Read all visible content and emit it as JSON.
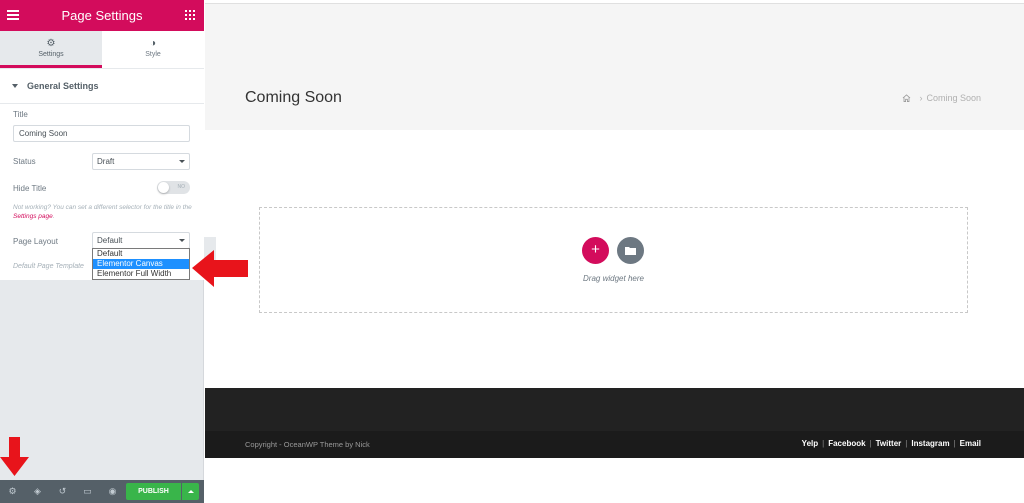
{
  "panel": {
    "header": {
      "title": "Page Settings"
    },
    "tabs": [
      {
        "label": "Settings",
        "active": true
      },
      {
        "label": "Style",
        "active": false
      }
    ],
    "section_title": "General Settings",
    "fields": {
      "title_label": "Title",
      "title_value": "Coming Soon",
      "status_label": "Status",
      "status_value": "Draft",
      "hide_title_label": "Hide Title",
      "hide_title_toggle": "NO",
      "note_prefix": "Not working? You can set a different selector for the title in the",
      "note_link": "Settings page",
      "note_suffix": ".",
      "page_layout_label": "Page Layout",
      "page_layout_value": "Default",
      "page_layout_options": [
        "Default",
        "Elementor Canvas",
        "Elementor Full Width"
      ],
      "page_layout_highlighted": "Elementor Canvas",
      "page_template_note": "Default Page Template"
    },
    "footer": {
      "publish_label": "PUBLISH",
      "icons": [
        "gear-icon",
        "layers-icon",
        "history-icon",
        "responsive-icon",
        "eye-icon"
      ]
    }
  },
  "preview": {
    "page_title": "Coming Soon",
    "breadcrumb": {
      "current": "Coming Soon"
    },
    "drop_zone_text": "Drag widget here",
    "copyright": "Copyright - OceanWP Theme by Nick",
    "social_links": [
      "Yelp",
      "Facebook",
      "Twitter",
      "Instagram",
      "Email"
    ]
  },
  "colors": {
    "accent": "#d30c5c",
    "publish_green": "#39b54a",
    "panel_bg": "#e6e9ec",
    "annotation_red": "#e8141b"
  }
}
